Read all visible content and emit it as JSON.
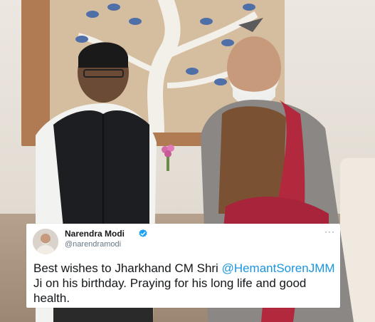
{
  "tweet": {
    "author_name": "Narendra Modi",
    "handle": "@narendramodi",
    "text_before": "Best wishes to Jharkhand CM Shri ",
    "mention": "@HemantSorenJMM",
    "text_after": " Ji on his birthday. Praying for his long life and good health.",
    "more_label": "···"
  },
  "colors": {
    "mention": "#1b95e0",
    "verified_badge": "#1da1f2"
  },
  "icons": {
    "verified": "verified-badge-icon",
    "more": "more-options-icon"
  }
}
